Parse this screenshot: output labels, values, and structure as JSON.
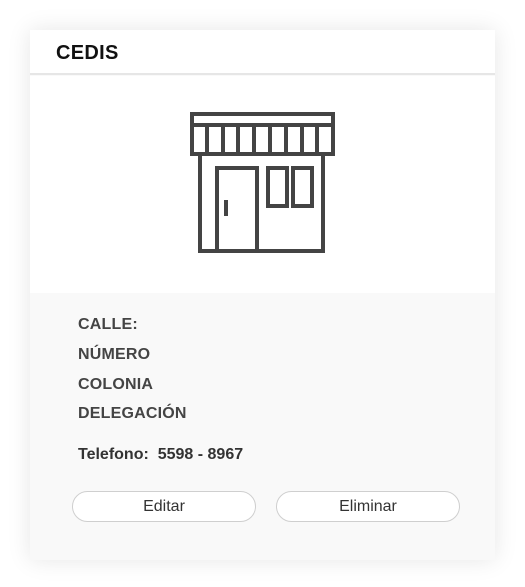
{
  "card": {
    "title": "CEDIS",
    "image_icon": "store-front-icon",
    "address": {
      "street": "CALLE:",
      "number": "NÚMERO",
      "colony": "COLONIA",
      "delegation": "DELEGACIÓN"
    },
    "phone": {
      "label": "Telefono:",
      "value": "5598 - 8967"
    },
    "actions": {
      "edit_label": "Editar",
      "delete_label": "Eliminar"
    }
  },
  "colors": {
    "icon_stroke": "#444444",
    "card_background": "#f9f9f9"
  }
}
